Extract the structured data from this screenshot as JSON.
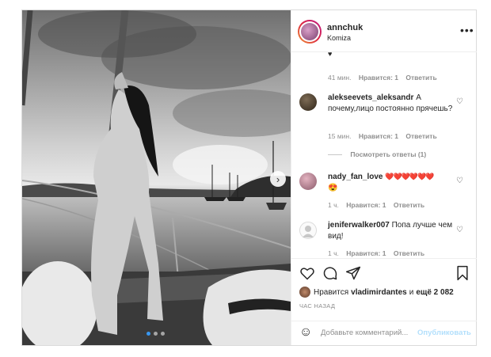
{
  "post": {
    "username": "annchuk",
    "location": "Komiza",
    "more_label": "•••",
    "carousel_dots": 3,
    "next_label": "›"
  },
  "comments": [
    {
      "meta_time": "41 мин.",
      "meta_likes": "Нравится: 1",
      "meta_reply": "Ответить"
    },
    {
      "username": "alekseevets_aleksandr",
      "text_first": "А",
      "text_rest": "почему,лицо постоянно прячешь?",
      "meta_time": "15 мин.",
      "meta_likes": "Нравится: 1",
      "meta_reply": "Ответить",
      "replies_label": "Посмотреть ответы (1)"
    },
    {
      "username": "nady_fan_love",
      "text": "❤️❤️❤️❤️❤️❤️",
      "text_line2": "😍",
      "meta_time": "1 ч.",
      "meta_likes": "Нравится: 1",
      "meta_reply": "Ответить"
    },
    {
      "username": "jeniferwalker007",
      "text_first": "Попа лучше",
      "text_rest": "чем вид!",
      "meta_time": "1 ч.",
      "meta_likes": "Нравится: 1",
      "meta_reply": "Ответить"
    }
  ],
  "likes": {
    "prefix": "Нравится",
    "user": "vladimirdantes",
    "middle": "и",
    "others": "ещё 2 082"
  },
  "time_ago": "ЧАС НАЗАД",
  "add_comment": {
    "placeholder": "Добавьте комментарий...",
    "publish_label": "Опубликовать"
  },
  "colors": {
    "accent": "#3897f0",
    "publish_disabled": "#b2dffc",
    "heart_red": "#ed4956"
  }
}
